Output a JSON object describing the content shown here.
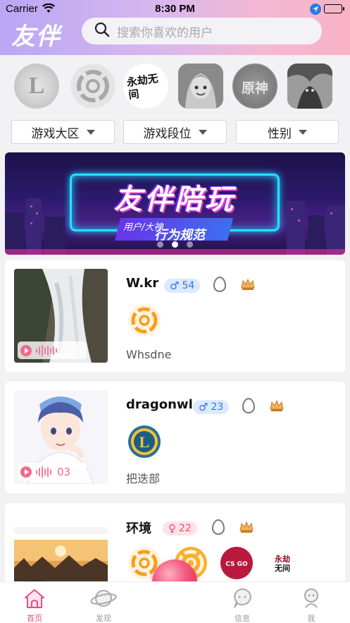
{
  "status_bar": {
    "carrier": "Carrier",
    "time": "8:30 PM"
  },
  "header": {
    "brand": "友伴",
    "search_placeholder": "搜索你喜欢的用户"
  },
  "games": [
    {
      "name": "league-of-legends",
      "label": "L"
    },
    {
      "name": "overwatch",
      "label": ""
    },
    {
      "name": "naraka-bladepoint",
      "label": "永劫无间"
    },
    {
      "name": "arena-of-valor",
      "label": ""
    },
    {
      "name": "genshin-impact",
      "label": "原神"
    },
    {
      "name": "dota2",
      "label": ""
    }
  ],
  "filters": [
    {
      "label": "游戏大区"
    },
    {
      "label": "游戏段位"
    },
    {
      "label": "性别"
    }
  ],
  "banner": {
    "title": "友伴陪玩",
    "subtitle_small": "用户/大神",
    "subtitle_big": "行为规范",
    "active_dot": 1,
    "dot_count": 3
  },
  "users": [
    {
      "name": "W.kr",
      "gender": "♂",
      "age": "54",
      "gender_color": "#2d77e6",
      "desc": "Whsdne",
      "voice_duration": "",
      "games": [
        "overwatch"
      ]
    },
    {
      "name": "dragonwl",
      "gender": "♂",
      "age": "23",
      "gender_color": "#2d77e6",
      "desc": "把迭部",
      "voice_duration": "03",
      "games": [
        "league-of-legends"
      ]
    },
    {
      "name": "环境",
      "gender": "♀",
      "age": "22",
      "gender_color": "#ea4e6d",
      "desc": "",
      "voice_duration": "",
      "games": [
        "overwatch",
        "overwatch-orange",
        "csgo",
        "naraka-bladepoint"
      ]
    }
  ],
  "tabbar": [
    {
      "label": "首页",
      "active": true
    },
    {
      "label": "发现",
      "active": false
    },
    {
      "label": "信息",
      "active": false
    },
    {
      "label": "我",
      "active": false
    }
  ],
  "colors": {
    "accent": "#ea4e82",
    "male": "#2d77e6",
    "female": "#ea4e6d",
    "overwatch": "#f99e1a"
  }
}
